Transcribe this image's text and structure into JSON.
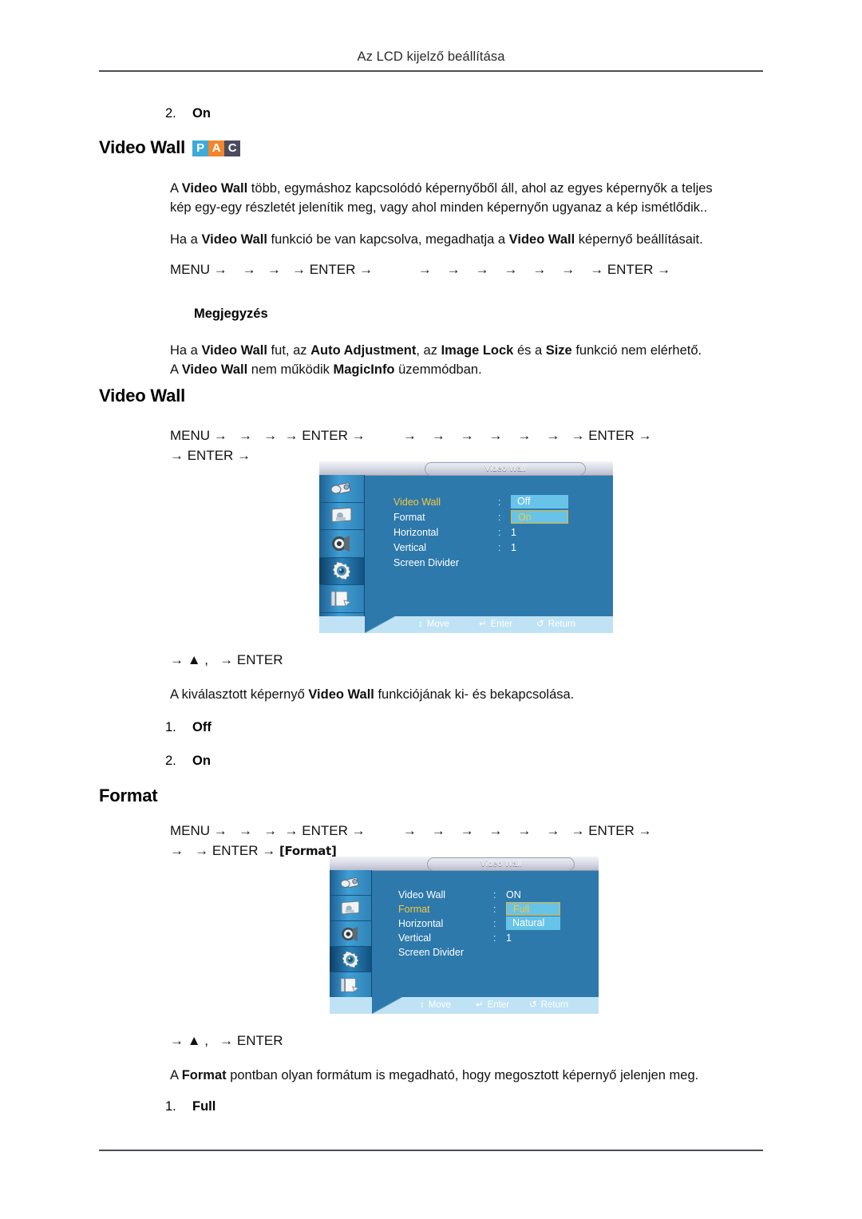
{
  "page": {
    "running_head": "Az LCD kijelző beállítása"
  },
  "top_item": {
    "number": "2.",
    "label": "On"
  },
  "section_video_wall_badged": {
    "heading": "Video Wall",
    "badge": [
      "P",
      "A",
      "C"
    ],
    "badge_colors": [
      "#3fa9d8",
      "#f2862e",
      "#4b4b5e"
    ],
    "paragraph_1_line_1_pre": "A ",
    "paragraph_1_bold_1": "Video Wall",
    "paragraph_1_line_1_post": " több, egymáshoz kapcsolódó képernyőből áll, ahol az egyes képernyők a teljes",
    "paragraph_1_line_2": "kép egy-egy részletét jelenítik meg, vagy ahol minden képernyőn ugyanaz a kép ismétlődik..",
    "paragraph_2_pre": "Ha a ",
    "paragraph_2_bold_1": "Video Wall",
    "paragraph_2_mid": " funkció be van kapcsolva, megadhatja a ",
    "paragraph_2_bold_2": "Video Wall",
    "paragraph_2_post": " képernyő beállításait.",
    "nav_line": "MENU →    →   →   → ENTER →            →    →    →    →    →    →    → ENTER →"
  },
  "note": {
    "title": "Megjegyzés",
    "line_1_pre": "Ha a ",
    "line_1_b1": "Video Wall",
    "line_1_m1": " fut, az ",
    "line_1_b2": "Auto Adjustment",
    "line_1_m2": ", az ",
    "line_1_b3": "Image Lock",
    "line_1_m3": " és a ",
    "line_1_b4": "Size",
    "line_1_post": " funkció nem elérhető.",
    "line_2_pre": "A ",
    "line_2_b1": "Video Wall",
    "line_2_m1": " nem működik ",
    "line_2_b2": "MagicInfo",
    "line_2_post": " üzemmódban."
  },
  "section_video_wall": {
    "heading": "Video Wall",
    "nav_line_1": "MENU →   →   →  → ENTER →          →    →    →    →    →    →   → ENTER →",
    "nav_line_2": "→ ENTER →",
    "after_nav": "→ ▲ ,   → ENTER",
    "description_pre": "A kiválasztott képernyő ",
    "description_bold": "Video Wall",
    "description_post": " funkciójának ki- és bekapcsolása.",
    "options": [
      {
        "number": "1.",
        "label": "Off"
      },
      {
        "number": "2.",
        "label": "On"
      }
    ]
  },
  "section_format": {
    "heading": "Format",
    "nav_line_1": "MENU →   →   →  → ENTER →          →    →    →    →    →    →   → ENTER →",
    "nav_line_2_pre": "→   → ENTER → ",
    "nav_line_2_token": "[Format]",
    "after_nav": "→ ▲ ,   → ENTER",
    "description_pre": "A ",
    "description_bold": "Format",
    "description_post": " pontban olyan formátum is megadható, hogy megosztott képernyő jelenjen meg.",
    "options": [
      {
        "number": "1.",
        "label": "Full"
      }
    ]
  },
  "osd_1": {
    "title": "Video Wall",
    "sidebar_icons": [
      "input-source-icon",
      "picture-display-icon",
      "sound-speaker-icon",
      "setup-gear-icon",
      "multi-control-icon"
    ],
    "active_icon_index": 3,
    "rows": [
      {
        "label": "Video Wall",
        "selected": true,
        "colon": ":",
        "value": ""
      },
      {
        "label": "Format",
        "selected": false,
        "colon": ":",
        "value": ""
      },
      {
        "label": "Horizontal",
        "selected": false,
        "colon": ":",
        "value": "1"
      },
      {
        "label": "Vertical",
        "selected": false,
        "colon": ":",
        "value": "1"
      },
      {
        "label": "Screen Divider",
        "selected": false,
        "colon": "",
        "value": ""
      }
    ],
    "dropdown": [
      {
        "text": "Off",
        "boxed": false
      },
      {
        "text": "On",
        "boxed": true
      }
    ],
    "footer": [
      {
        "glyph": "↕",
        "label": "Move"
      },
      {
        "glyph": "↵",
        "label": "Enter"
      },
      {
        "glyph": "↺",
        "label": "Return"
      }
    ]
  },
  "osd_2": {
    "title": "Video Wall",
    "sidebar_icons": [
      "input-source-icon",
      "picture-display-icon",
      "sound-speaker-icon",
      "setup-gear-icon",
      "multi-control-icon"
    ],
    "active_icon_index": 3,
    "rows": [
      {
        "label": "Video Wall",
        "selected": false,
        "colon": ":",
        "value": "ON"
      },
      {
        "label": "Format",
        "selected": true,
        "colon": ":",
        "value": ""
      },
      {
        "label": "Horizontal",
        "selected": false,
        "colon": ":",
        "value": ""
      },
      {
        "label": "Vertical",
        "selected": false,
        "colon": ":",
        "value": "1"
      },
      {
        "label": "Screen Divider",
        "selected": false,
        "colon": "",
        "value": ""
      }
    ],
    "dropdown": [
      {
        "text": "Full",
        "boxed": true
      },
      {
        "text": "Natural",
        "boxed": false
      }
    ],
    "footer": [
      {
        "glyph": "↕",
        "label": "Move"
      },
      {
        "glyph": "↵",
        "label": "Enter"
      },
      {
        "glyph": "↺",
        "label": "Return"
      }
    ]
  }
}
